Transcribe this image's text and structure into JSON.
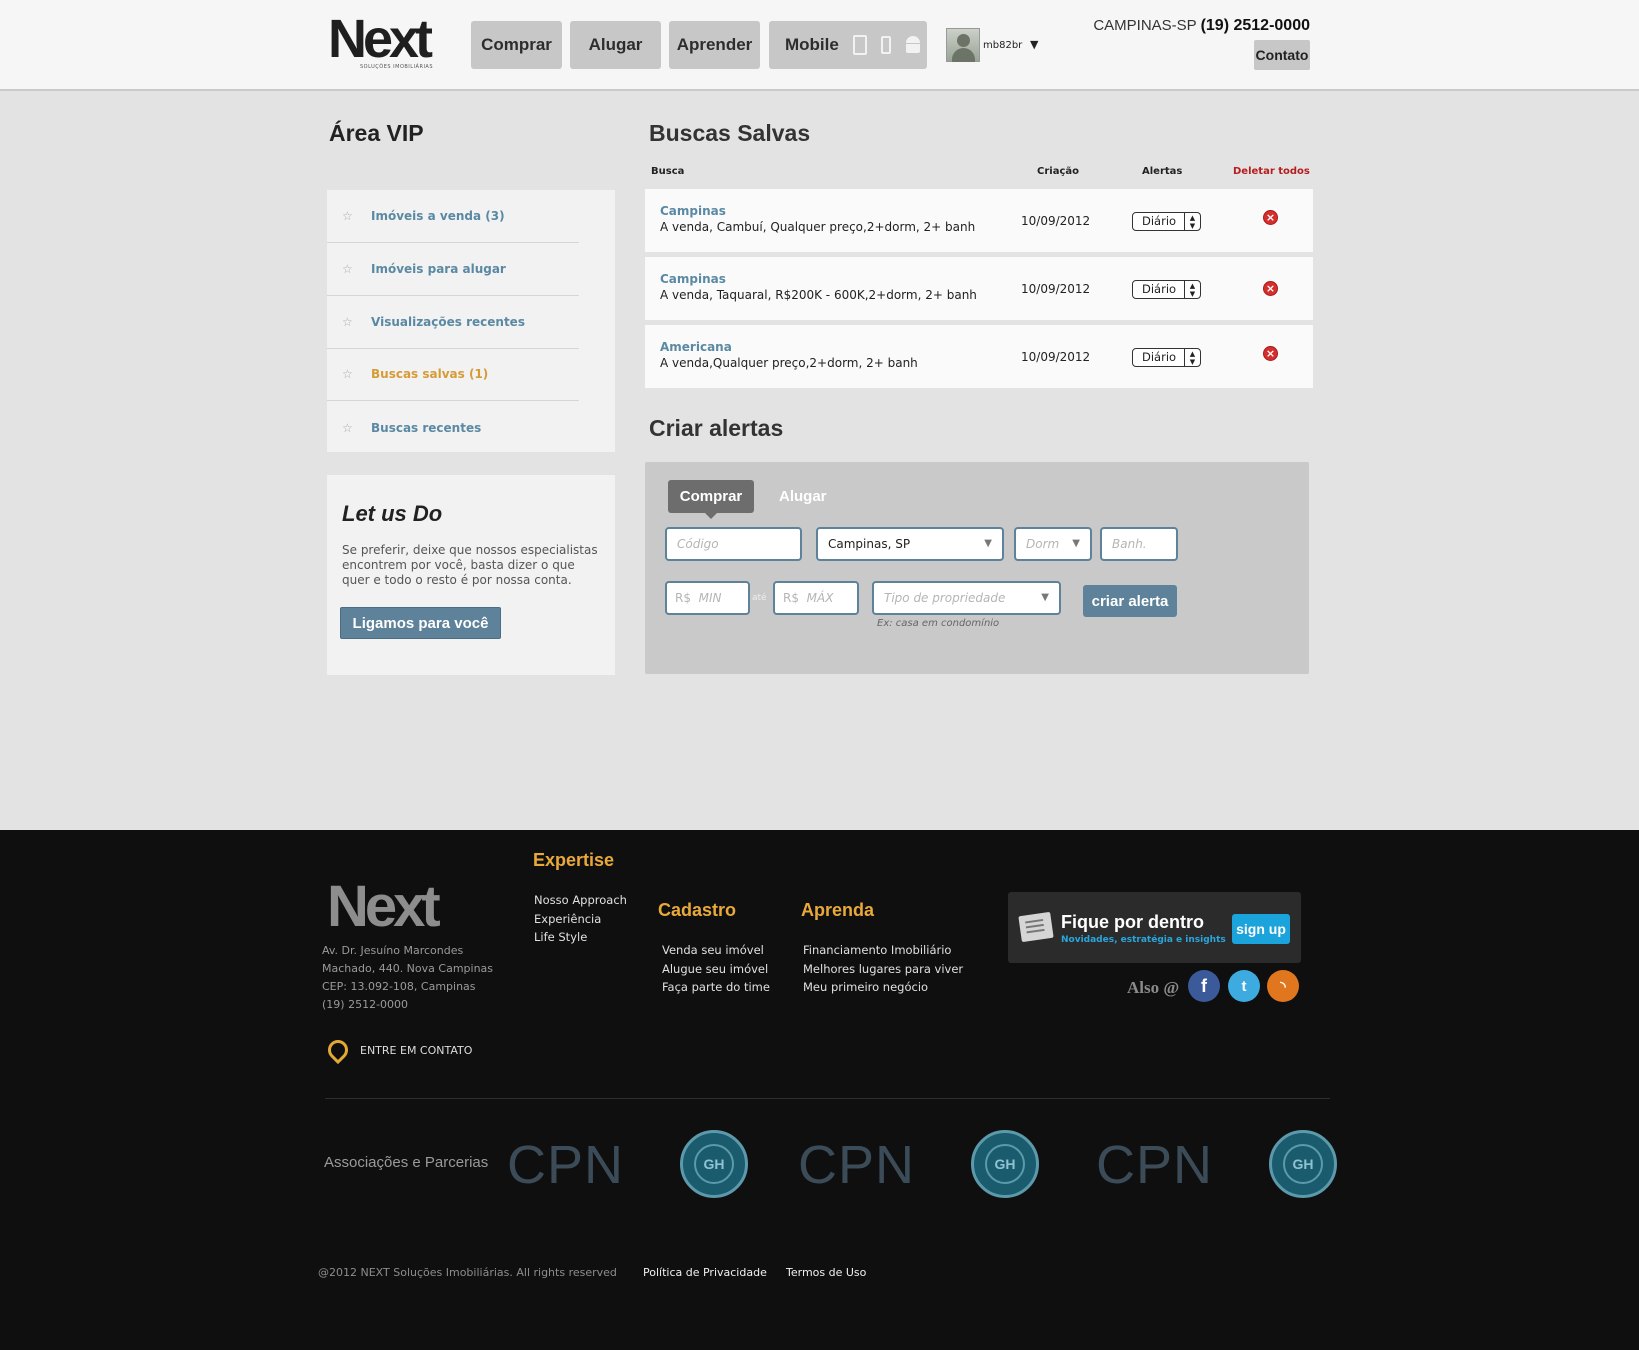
{
  "header": {
    "logo_text": "Next",
    "logo_tagline": "SOLUÇÕES IMOBILIÁRIAS",
    "nav": [
      {
        "label": "Comprar"
      },
      {
        "label": "Alugar"
      },
      {
        "label": "Aprender"
      },
      {
        "label": "Mobile"
      }
    ],
    "username": "mb82br",
    "city_prefix": "CAMPINAS-SP",
    "phone": "(19) 2512-0000",
    "contact_label": "Contato"
  },
  "sidebar": {
    "title": "Área VIP",
    "items": [
      {
        "label": "Imóveis a venda (3)",
        "active": false
      },
      {
        "label": "Imóveis para alugar",
        "active": false
      },
      {
        "label": "Visualizações recentes",
        "active": false
      },
      {
        "label": "Buscas salvas (1)",
        "active": true
      },
      {
        "label": "Buscas recentes",
        "active": false
      }
    ],
    "letusdo": {
      "title": "Let us Do",
      "text": "Se preferir, deixe que nossos especialistas encontrem por você, basta dizer o que quer e todo o resto é por nossa conta.",
      "button": "Ligamos para você"
    }
  },
  "saved": {
    "title": "Buscas Salvas",
    "headers": {
      "busca": "Busca",
      "criacao": "Criação",
      "alertas": "Alertas",
      "deletar": "Deletar todos"
    },
    "rows": [
      {
        "city": "Campinas",
        "desc": "A venda, Cambuí, Qualquer preço,2+dorm, 2+ banh",
        "date": "10/09/2012",
        "alert": "Diário"
      },
      {
        "city": "Campinas",
        "desc": "A venda, Taquaral, R$200K - 600K,2+dorm, 2+ banh",
        "date": "10/09/2012",
        "alert": "Diário"
      },
      {
        "city": "Americana",
        "desc": "A venda,Qualquer preço,2+dorm, 2+ banh",
        "date": "10/09/2012",
        "alert": "Diário"
      }
    ]
  },
  "create": {
    "title": "Criar alertas",
    "tab_active": "Comprar",
    "tab_other": "Alugar",
    "codigo_placeholder": "Código",
    "city_value": "Campinas, SP",
    "dorm_placeholder": "Dorm",
    "banh_placeholder": "Banh.",
    "min_prefix": "R$",
    "min_placeholder": "MIN",
    "ate": "até",
    "max_prefix": "R$",
    "max_placeholder": "MÁX",
    "tipo_placeholder": "Tipo de propriedade",
    "hint": "Ex: casa em condomínio",
    "button": "criar alerta"
  },
  "footer": {
    "logo_text": "Next",
    "address": [
      "Av. Dr. Jesuíno Marcondes",
      "Machado, 440. Nova Campinas",
      "CEP: 13.092-108, Campinas",
      "(19) 2512-0000"
    ],
    "contact": "ENTRE EM CONTATO",
    "expertise": {
      "title": "Expertise",
      "links": [
        "Nosso Approach",
        "Experiência",
        "Life Style"
      ]
    },
    "cadastro": {
      "title": "Cadastro",
      "links": [
        "Venda seu imóvel",
        "Alugue seu imóvel",
        "Faça parte do time"
      ]
    },
    "aprenda": {
      "title": "Aprenda",
      "links": [
        "Financiamento Imobiliário",
        "Melhores lugares para viver",
        "Meu primeiro negócio"
      ]
    },
    "newsletter": {
      "title": "Fique por dentro",
      "subtitle": "Novidades, estratégia e insights",
      "button": "sign up"
    },
    "also": "Also @",
    "social_icons": [
      "facebook-icon",
      "twitter-icon",
      "rss-icon"
    ],
    "assoc_label": "Associações e Parcerias",
    "partners": [
      "CPN",
      "CPN",
      "CPN"
    ],
    "copyright": "@2012 NEXT Soluções Imobiliárias. All rights reserved",
    "privacy": "Política de Privacidade",
    "terms": "Termos de Uso"
  },
  "colors": {
    "accent_blue": "#5d8299",
    "accent_orange": "#e9a93a",
    "link_blue": "#5b89a3",
    "delete_red": "#b61d1d"
  }
}
